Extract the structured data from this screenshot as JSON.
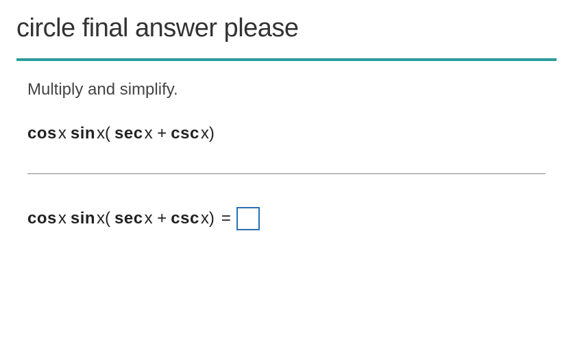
{
  "heading": "circle final answer please",
  "instruction": "Multiply and simplify.",
  "expression": {
    "fn1": "cos",
    "var1": "x ",
    "fn2": "sin",
    "var2": "x( ",
    "fn3": "sec",
    "var3": "x + ",
    "fn4": "csc",
    "var4": "x)"
  },
  "answer_line": {
    "fn1": "cos",
    "var1": "x ",
    "fn2": "sin",
    "var2": "x( ",
    "fn3": "sec",
    "var3": "x + ",
    "fn4": "csc",
    "var4": "x) ",
    "equals": "="
  }
}
